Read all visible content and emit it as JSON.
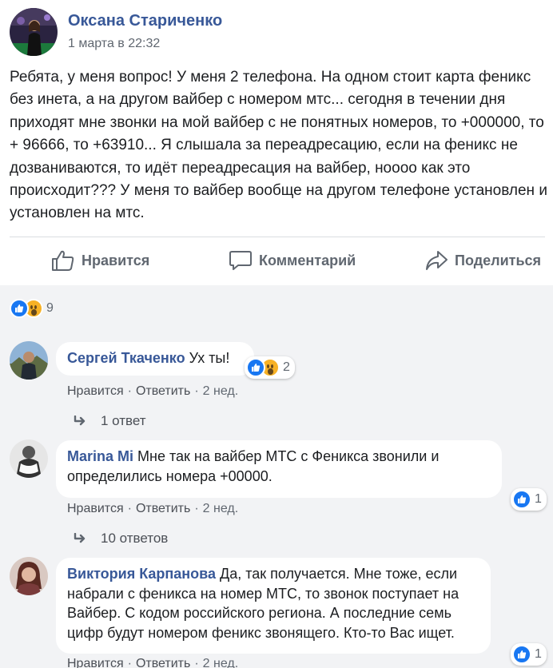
{
  "post": {
    "author": "Оксана Стариченко",
    "time": "1 марта в 22:32",
    "text": "Ребята, у меня вопрос! У меня 2 телефона. На одном стоит карта феникс без инета, а на другом вайбер с номером мтс... сегодня в течении дня приходят мне звонки на мой вайбер с не понятных номеров, то +000000, то + 96666, то +63910... Я слышала за переадресацию, если на феникс не дозваниваются, то идёт переадресация на вайбер, ноооо как это происходит??? У меня то вайбер вообще на другом телефоне установлен и установлен на мтс."
  },
  "actions": {
    "like": "Нравится",
    "comment": "Комментарий",
    "share": "Поделиться"
  },
  "reactions_summary": {
    "count": "9",
    "icons": [
      "like-icon",
      "wow-icon"
    ]
  },
  "comments": [
    {
      "author": "Сергей Ткаченко",
      "text": "Ух ты!",
      "like": "Нравится",
      "reply": "Ответить",
      "age": "2 нед.",
      "reactions": "2",
      "replies": "1 ответ"
    },
    {
      "author": "Marina Mi",
      "text": "Мне так на вайбер МТС с Феникса звонили и определились номера +00000.",
      "like": "Нравится",
      "reply": "Ответить",
      "age": "2 нед.",
      "reactions": "1",
      "replies": "10 ответов"
    },
    {
      "author": "Виктория Карпанова",
      "text": "Да, так получается. Мне тоже, если набрали с феникса на номер МТС, то звонок поступает на Вайбер. С кодом российского региона. А последние семь цифр будут номером феникс звонящего. Кто-то Вас ищет.",
      "like": "Нравится",
      "reply": "Ответить",
      "age": "2 нед.",
      "reactions": "1"
    }
  ],
  "colors": {
    "name_link": "#385898",
    "like_blue": "#1877f2",
    "wow_yellow": "#f7b125",
    "comments_bg": "#f2f3f5"
  }
}
